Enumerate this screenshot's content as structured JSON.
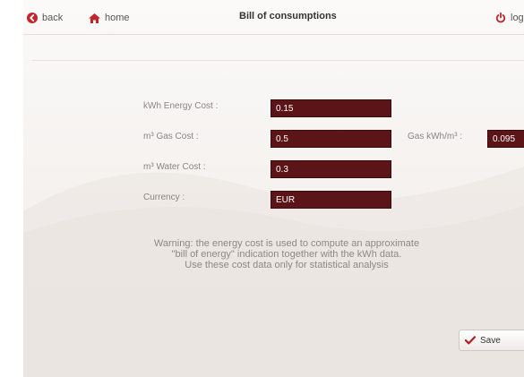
{
  "header": {
    "back_label": "back",
    "home_label": "home",
    "title": "Bill of consumptions",
    "logout_label": "logout"
  },
  "form": {
    "energy_cost": {
      "label": "kWh Energy Cost :",
      "value": "0.15"
    },
    "gas_cost": {
      "label": "m³ Gas Cost :",
      "value": "0.5"
    },
    "gas_kwh": {
      "label": "Gas kWh/m³ :",
      "value": "0.095"
    },
    "water_cost": {
      "label": "m³ Water Cost :",
      "value": "0.3"
    },
    "currency": {
      "label": "Currency :",
      "value": "EUR"
    }
  },
  "warning": {
    "line1": "Warning: the energy cost is used to compute an approximate",
    "line2": "\"bill of energy\" indication together with the kWh data.",
    "line3": "Use these cost data only for statistical analysis"
  },
  "footer": {
    "save_label": "Save"
  },
  "colors": {
    "field_bg": "#5b1518",
    "accent_red": "#c0272d",
    "check_red": "#b01f24"
  },
  "icons": {
    "back": "circle-chevron-left-icon",
    "home": "home-icon",
    "logout": "power-icon",
    "save": "checkmark-icon"
  }
}
